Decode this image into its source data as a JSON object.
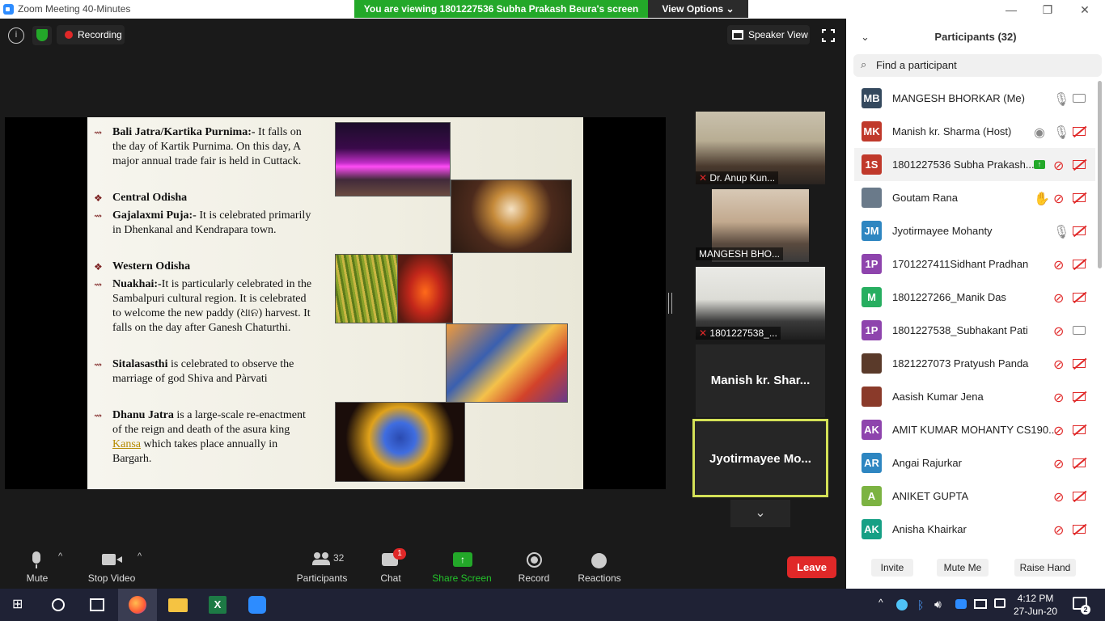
{
  "window": {
    "title": "Zoom Meeting 40-Minutes",
    "viewing_banner": "You are viewing 1801227536 Subha Prakash Beura's screen",
    "view_options": "View Options",
    "minimize": "—",
    "restore": "❐",
    "close": "✕"
  },
  "top_controls": {
    "info": "i",
    "recording": "Recording",
    "speaker_view": "Speaker View"
  },
  "slide": {
    "blocks": [
      {
        "heading": "Bali Jatra/Kartika Purnima:-",
        "lines": [
          " It falls on",
          "the day of Kartik Purnima.  On this day, A",
          "major annual trade fair is  held in Cuttack."
        ]
      },
      {
        "heading": "Central Odisha"
      },
      {
        "heading": "Gajalaxmi Puja:-",
        "lines": [
          " It is celebrated primarily",
          "in Dhenkanal and Kendrapara town."
        ]
      },
      {
        "heading": "Western Odisha"
      },
      {
        "heading": "Nuakhai:-",
        "lines": [
          "It is particularly celebrated in the",
          "Sambalpuri  cultural  region.  It  is  celebrated",
          "to welcome the new paddy (ଧାନ) harvest. It",
          "falls on the day after Ganesh Chaturthi."
        ]
      },
      {
        "heading": "Sitalasasthi",
        "lines": [
          " is celebrated to observe the",
          "marriage of god Shiva and Pàrvati"
        ]
      },
      {
        "heading": "Dhanu Jatra",
        "lines": [
          " is a large-scale re-enactment",
          "of the reign and death of the asura king",
          "Kansa",
          " which takes place annually  in",
          "Bargarh."
        ]
      }
    ]
  },
  "video_tiles": [
    {
      "name": "Dr. Anup Kun..."
    },
    {
      "name": "MANGESH BHO..."
    },
    {
      "name": "1801227538_..."
    },
    {
      "name": "Manish kr. Shar..."
    },
    {
      "name": "Jyotirmayee  Mo..."
    }
  ],
  "toolbar": {
    "mute": "Mute",
    "stop_video": "Stop Video",
    "participants": "Participants",
    "participants_count": "32",
    "chat": "Chat",
    "chat_badge": "1",
    "share_screen": "Share Screen",
    "record": "Record",
    "reactions": "Reactions",
    "leave": "Leave"
  },
  "panel": {
    "title": "Participants (32)",
    "search_placeholder": "Find a participant",
    "participants": [
      {
        "initials": "MB",
        "color": "#34495e",
        "name": "MANGESH BHORKAR (Me)",
        "mic": "on",
        "cam": "on"
      },
      {
        "initials": "MK",
        "color": "#c0392b",
        "name": "Manish kr. Sharma (Host)",
        "mic": "on",
        "cam": "off",
        "extra": "record"
      },
      {
        "initials": "1S",
        "color": "#c0392b",
        "name": "1801227536 Subha Prakash...",
        "mic": "off",
        "cam": "off",
        "extra": "share"
      },
      {
        "initials": "",
        "color": "#6a7a8a",
        "name": "Goutam Rana",
        "mic": "off",
        "cam": "off",
        "extra": "hand"
      },
      {
        "initials": "JM",
        "color": "#2e86c1",
        "name": "Jyotirmayee Mohanty",
        "mic": "on",
        "cam": "off"
      },
      {
        "initials": "1P",
        "color": "#8e44ad",
        "name": "1701227411Sidhant Pradhan",
        "mic": "off",
        "cam": "off"
      },
      {
        "initials": "M",
        "color": "#27ae60",
        "name": "1801227266_Manik Das",
        "mic": "off",
        "cam": "off"
      },
      {
        "initials": "1P",
        "color": "#8e44ad",
        "name": "1801227538_Subhakant Pati",
        "mic": "off",
        "cam": "on"
      },
      {
        "initials": "",
        "color": "#5a3a2a",
        "name": "1821227073 Pratyush Panda",
        "mic": "off",
        "cam": "off"
      },
      {
        "initials": "",
        "color": "#8a3a2a",
        "name": "Aasish Kumar Jena",
        "mic": "off",
        "cam": "off"
      },
      {
        "initials": "AK",
        "color": "#8e44ad",
        "name": "AMIT KUMAR MOHANTY CS190...",
        "mic": "off",
        "cam": "off"
      },
      {
        "initials": "AR",
        "color": "#2e86c1",
        "name": "Angai Rajurkar",
        "mic": "off",
        "cam": "off"
      },
      {
        "initials": "A",
        "color": "#7cb342",
        "name": "ANIKET GUPTA",
        "mic": "off",
        "cam": "off"
      },
      {
        "initials": "AK",
        "color": "#16a085",
        "name": "Anisha Khairkar",
        "mic": "off",
        "cam": "off"
      }
    ],
    "buttons": {
      "invite": "Invite",
      "mute_me": "Mute Me",
      "raise_hand": "Raise Hand"
    }
  },
  "taskbar": {
    "time": "4:12 PM",
    "date": "27-Jun-20",
    "notifications": "2"
  }
}
